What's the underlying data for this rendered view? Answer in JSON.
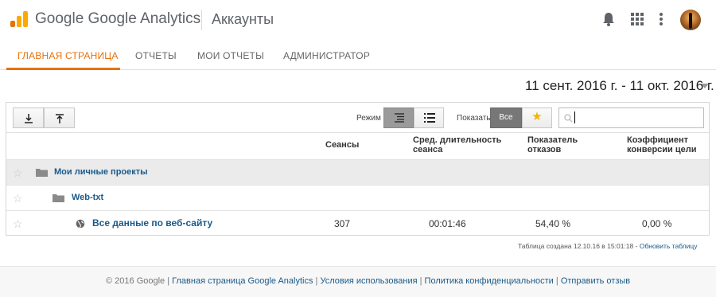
{
  "header": {
    "logo_text": "Google Google Analytics",
    "section_title": "Аккаунты"
  },
  "nav": {
    "tabs": [
      {
        "label": "ГЛАВНАЯ СТРАНИЦА",
        "active": true
      },
      {
        "label": "ОТЧЕТЫ",
        "active": false
      },
      {
        "label": "МОИ ОТЧЕТЫ",
        "active": false
      },
      {
        "label": "АДМИНИСТРАТОР",
        "active": false
      }
    ]
  },
  "date_range": "11 сент. 2016 г. - 11 окт. 2016 г.",
  "toolbar": {
    "mode_label": "Режим",
    "show_label": "Показать",
    "show_all": "Все",
    "search_value": ""
  },
  "table": {
    "columns": [
      "Сеансы",
      "Сред. длительность сеанса",
      "Показатель отказов",
      "Коэффициент конверсии цели"
    ],
    "rows": [
      {
        "name": "Мои личные проекты",
        "type": "account",
        "sessions": "",
        "duration": "",
        "bounce": "",
        "conversion": ""
      },
      {
        "name": "Web-txt",
        "type": "property",
        "sessions": "",
        "duration": "",
        "bounce": "",
        "conversion": ""
      },
      {
        "name": "Все данные по веб-сайту",
        "type": "view",
        "sessions": "307",
        "duration": "00:01:46",
        "bounce": "54,40 %",
        "conversion": "0,00 %"
      }
    ]
  },
  "table_footer": {
    "created_text": "Таблица создана 12.10.16 в 15:01:18 - ",
    "refresh_link": "Обновить таблицу"
  },
  "footer": {
    "copyright": "© 2016 Google",
    "links": [
      "Главная страница Google Analytics",
      "Условия использования",
      "Политика конфиденциальности",
      "Отправить отзыв"
    ]
  },
  "colors": {
    "accent": "#e8710a",
    "link": "#1a5a8a",
    "star": "#f4b400"
  }
}
